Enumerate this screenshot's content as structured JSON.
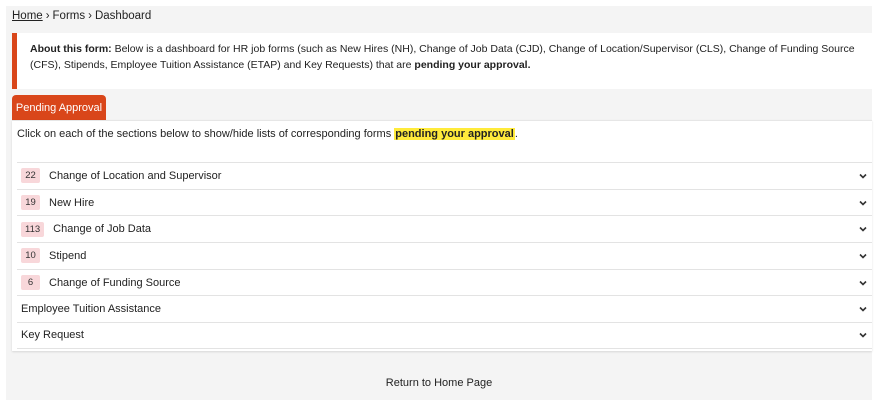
{
  "breadcrumb": {
    "home": "Home",
    "sep": "›",
    "forms": "Forms",
    "current": "Dashboard"
  },
  "about": {
    "label": "About this form:",
    "text": " Below is a dashboard for HR job forms (such as New Hires (NH), Change of Job Data (CJD), Change of Location/Supervisor (CLS), Change of Funding Source (CFS), Stipends, Employee Tuition Assistance (ETAP) and Key Requests) that are ",
    "emphasis": "pending your approval.",
    "accent_color": "#d9461a"
  },
  "tab": {
    "label": "Pending Approval"
  },
  "panel": {
    "intro_text": "Click on each of the sections below to show/hide lists of corresponding forms ",
    "intro_highlight": "pending your approval",
    "intro_end": ".",
    "highlight_color": "#ffeb3b"
  },
  "sections": [
    {
      "count": "22",
      "label": "Change of Location and Supervisor",
      "icon": "chevron-down-icon"
    },
    {
      "count": "19",
      "label": "New Hire",
      "icon": "chevron-down-icon"
    },
    {
      "count": "113",
      "label": "Change of Job Data",
      "icon": "chevron-down-icon"
    },
    {
      "count": "10",
      "label": "Stipend",
      "icon": "chevron-down-icon"
    },
    {
      "count": "6",
      "label": "Change of Funding Source",
      "icon": "chevron-down-icon"
    },
    {
      "count": "",
      "label": "Employee Tuition Assistance",
      "icon": "chevron-down-icon"
    },
    {
      "count": "",
      "label": "Key Request",
      "icon": "chevron-down-icon"
    }
  ],
  "footer": {
    "return_link": "Return to Home Page"
  },
  "colors": {
    "badge_bg": "#f8d7da",
    "frame_bg": "#f4f4f4"
  }
}
